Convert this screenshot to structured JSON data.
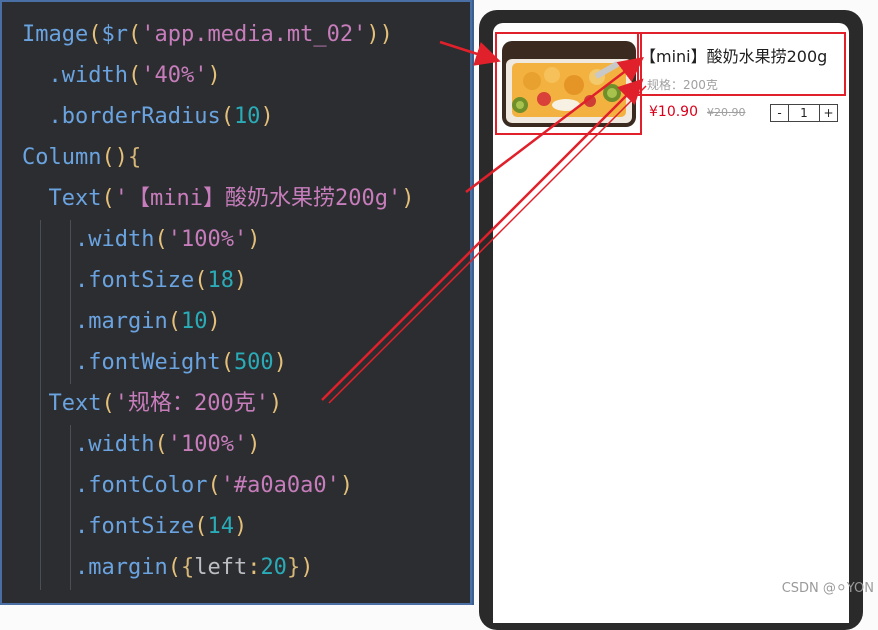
{
  "code": {
    "line1": {
      "pre": "Image",
      "p1": "(",
      "fn": "$r",
      "p2": "(",
      "str": "'app.media.mt_02'",
      "p3": "))"
    },
    "line2": {
      "method": ".width",
      "p1": "(",
      "str": "'40%'",
      "p2": ")"
    },
    "line3": {
      "method": ".borderRadius",
      "p1": "(",
      "num": "10",
      "p2": ")"
    },
    "line4": {
      "kw": "Column",
      "p1": "()",
      "p2": "{"
    },
    "line5": {
      "kw": "Text",
      "p1": "(",
      "str": "'【mini】酸奶水果捞200g'",
      "p2": ")"
    },
    "line6": {
      "method": ".width",
      "p1": "(",
      "str": "'100%'",
      "p2": ")"
    },
    "line7": {
      "method": ".fontSize",
      "p1": "(",
      "num": "18",
      "p2": ")"
    },
    "line8": {
      "method": ".margin",
      "p1": "(",
      "num": "10",
      "p2": ")"
    },
    "line9": {
      "method": ".fontWeight",
      "p1": "(",
      "num": "500",
      "p2": ")"
    },
    "line10": {
      "kw": "Text",
      "p1": "(",
      "str": "'规格：200克'",
      "p2": ")"
    },
    "line11": {
      "method": ".width",
      "p1": "(",
      "str": "'100%'",
      "p2": ")"
    },
    "line12": {
      "method": ".fontColor",
      "p1": "(",
      "str": "'#a0a0a0'",
      "p2": ")"
    },
    "line13": {
      "method": ".fontSize",
      "p1": "(",
      "num": "14",
      "p2": ")"
    },
    "line14": {
      "method": ".margin",
      "p1": "(",
      "b1": "{",
      "key": "left",
      "colon": ":",
      "num": "20",
      "b2": "}",
      "p2": ")"
    }
  },
  "preview": {
    "title": "【mini】酸奶水果捞200g",
    "spec": "规格：200克",
    "price": "¥10.90",
    "old_price": "¥20.90",
    "stepper": {
      "minus": "-",
      "value": "1",
      "plus": "+"
    }
  },
  "watermark": "CSDN @⚪YON",
  "colors": {
    "annotation": "#e0202a",
    "price": "#d9001b",
    "spec": "#a0a0a0"
  }
}
